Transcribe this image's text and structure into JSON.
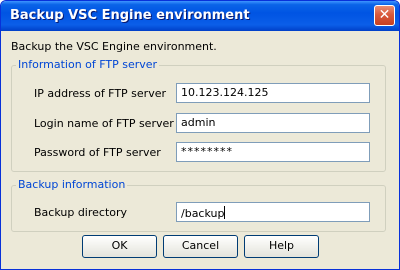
{
  "window": {
    "title": "Backup VSC Engine environment",
    "close_glyph": "✕"
  },
  "intro_text": "Backup the VSC Engine environment.",
  "ftp_group": {
    "title": "Information of FTP server",
    "ip_label": "IP address of FTP server",
    "ip_value": "10.123.124.125",
    "login_label": "Login name of FTP server",
    "login_value": "admin",
    "password_label": "Password of FTP server",
    "password_value": "********"
  },
  "backup_group": {
    "title": "Backup information",
    "dir_label": "Backup directory",
    "dir_value": "/backup"
  },
  "buttons": {
    "ok": "OK",
    "cancel": "Cancel",
    "help": "Help"
  },
  "colors": {
    "titlebar": "#0054e3",
    "group_title": "#0046d5",
    "dialog_bg": "#ece9d8"
  },
  "icons": {
    "close": "close-icon"
  }
}
